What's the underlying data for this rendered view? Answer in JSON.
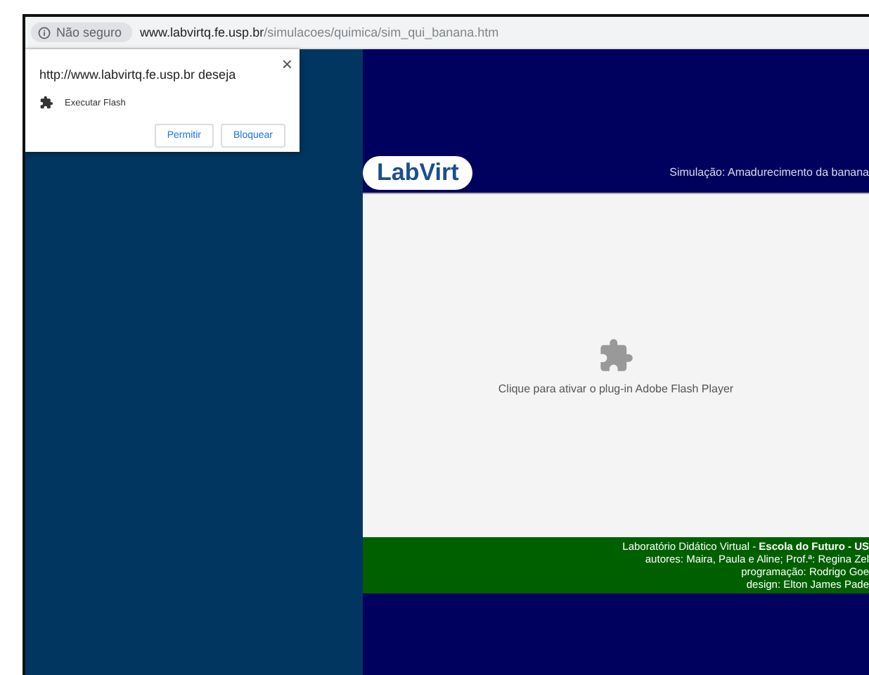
{
  "address_bar": {
    "security": "Não seguro",
    "host": "www.labvirtq.fe.usp.br",
    "path": "/simulacoes/quimica/sim_qui_banana.htm"
  },
  "permission_popup": {
    "title": "http://www.labvirtq.fe.usp.br deseja",
    "close": "×",
    "permission": "Executar Flash",
    "buttons": [
      "Permitir",
      "Bloquear"
    ]
  },
  "page": {
    "logo": "LabVirt",
    "simulation_title": "Simulação: Amadurecimento da banana",
    "plugin_message": "Clique para ativar o plug-in Adobe Flash Player",
    "footer": [
      "Laboratório Didático Virtual - **Escola do Futuro - US**",
      "autores: Maira, Paula e Aline; Prof.ª: Regina Zel",
      "programação: Rodrigo Goe",
      "design: Elton James Pade"
    ]
  }
}
